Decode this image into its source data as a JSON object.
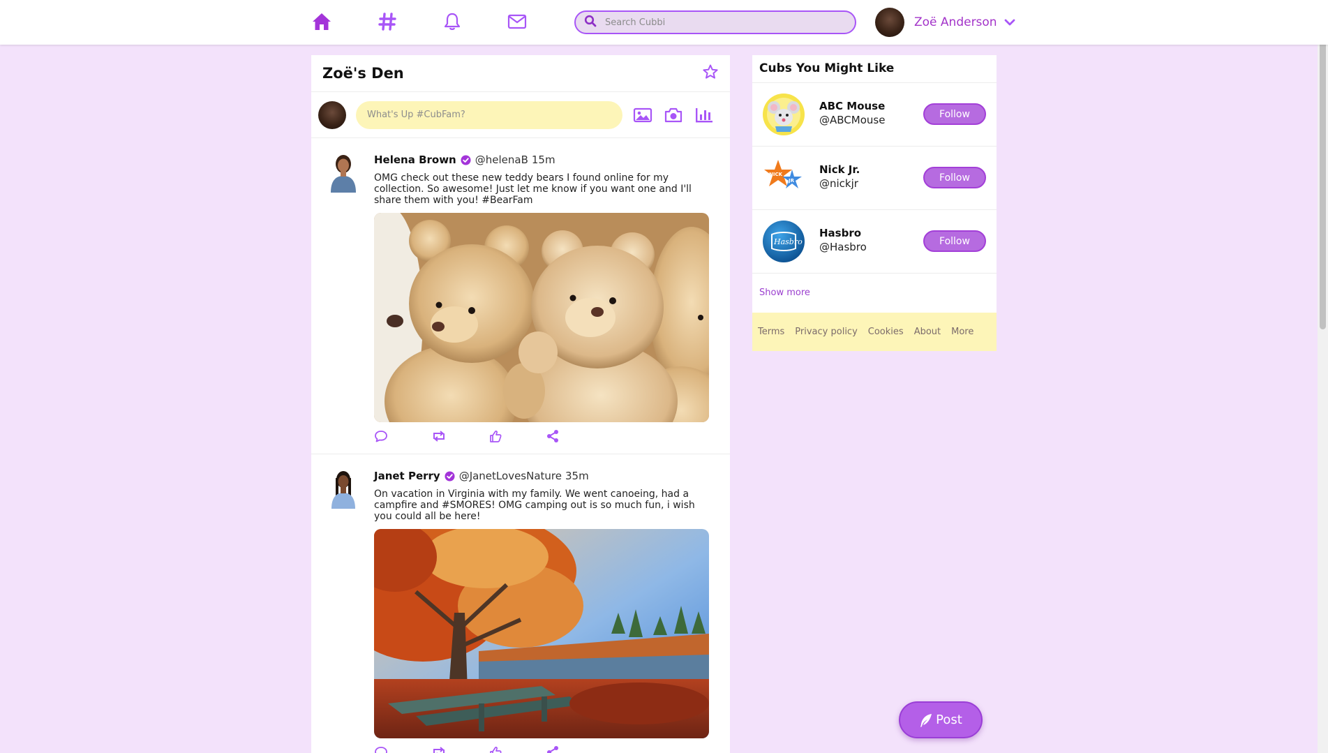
{
  "nav": {
    "icons": [
      "home-icon",
      "hashtag-icon",
      "bell-icon",
      "envelope-icon"
    ],
    "search_placeholder": "Search Cubbi",
    "user_name": "Zoë Anderson",
    "accent": "#a855f7"
  },
  "feed": {
    "title": "Zoë's Den",
    "composer_placeholder": "What's Up #CubFam?",
    "posts": [
      {
        "name": "Helena Brown",
        "handle": "@helenaB",
        "time": "15m",
        "text": "OMG check out these new teddy bears I found online for my collection. So awesome! Just let me know if you want one and I'll share them with you! #BearFam"
      },
      {
        "name": "Janet Perry",
        "handle": "@JanetLovesNature",
        "time": "35m",
        "text": "On vacation in Virginia with my family. We went canoeing, had a campfire and #SMORES! OMG camping out is so much fun, i wish you could all be here!"
      }
    ]
  },
  "sidebar": {
    "title": "Cubs You Might Like",
    "suggestions": [
      {
        "name": "ABC Mouse",
        "handle": "@ABCMouse",
        "button": "Follow"
      },
      {
        "name": "Nick Jr.",
        "handle": "@nickjr",
        "button": "Follow"
      },
      {
        "name": "Hasbro",
        "handle": "@Hasbro",
        "button": "Follow"
      }
    ],
    "show_more": "Show more",
    "footer_links": [
      "Terms",
      "Privacy policy",
      "Cookies",
      "About",
      "More"
    ]
  },
  "fab": {
    "label": "Post"
  }
}
